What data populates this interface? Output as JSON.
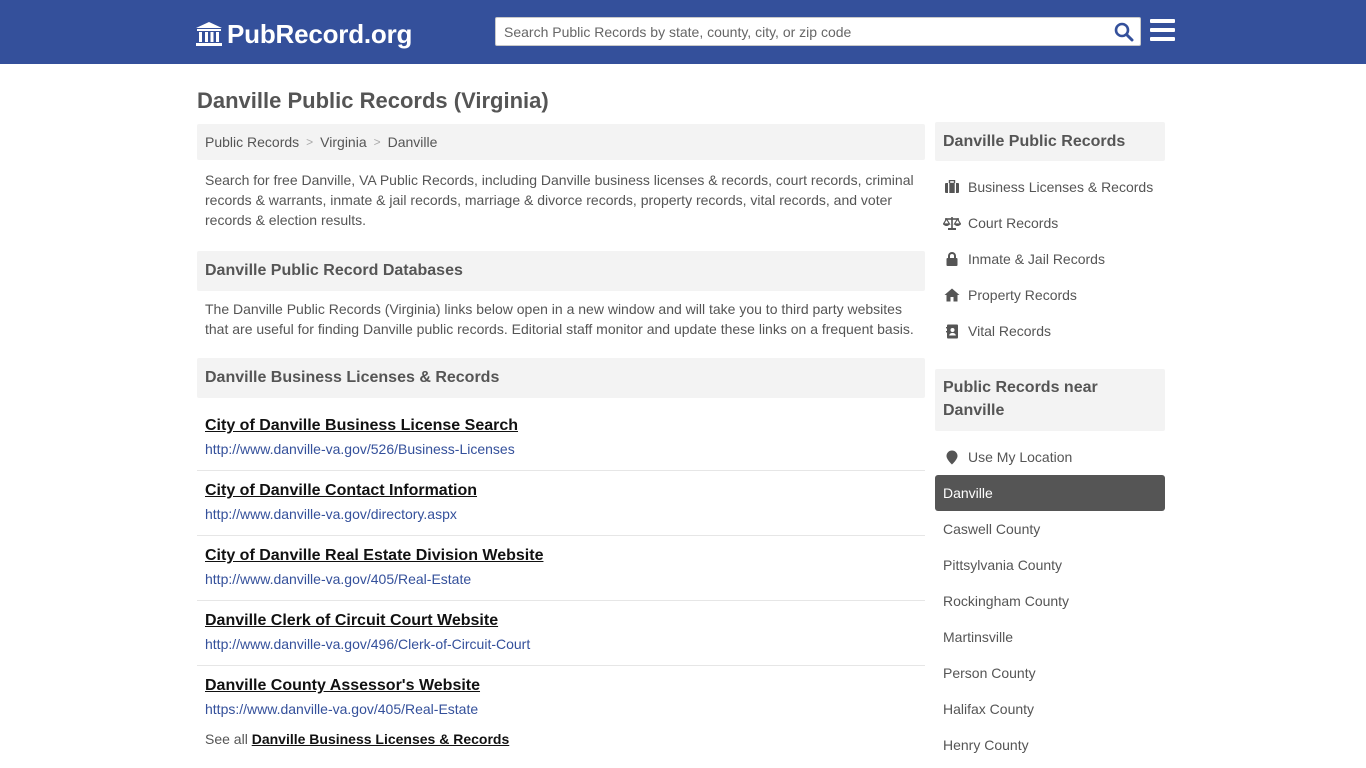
{
  "header": {
    "logo_text": "PubRecord.org",
    "search_placeholder": "Search Public Records by state, county, city, or zip code",
    "colors": {
      "bar": "#34509b",
      "link": "#34509b"
    }
  },
  "page_title": "Danville Public Records (Virginia)",
  "breadcrumb": [
    "Public Records",
    "Virginia",
    "Danville"
  ],
  "intro": "Search for free Danville, VA Public Records, including Danville business licenses & records, court records, criminal records & warrants, inmate & jail records, marriage & divorce records, property records, vital records, and voter records & election results.",
  "databases": {
    "heading": "Danville Public Record Databases",
    "description": "The Danville Public Records (Virginia) links below open in a new window and will take you to third party websites that are useful for finding Danville public records. Editorial staff monitor and update these links on a frequent basis."
  },
  "business": {
    "heading": "Danville Business Licenses & Records",
    "records": [
      {
        "title": "City of Danville Business License Search",
        "url": "http://www.danville-va.gov/526/Business-Licenses"
      },
      {
        "title": "City of Danville Contact Information",
        "url": "http://www.danville-va.gov/directory.aspx"
      },
      {
        "title": "City of Danville Real Estate Division Website",
        "url": "http://www.danville-va.gov/405/Real-Estate"
      },
      {
        "title": "Danville Clerk of Circuit Court Website",
        "url": "http://www.danville-va.gov/496/Clerk-of-Circuit-Court"
      },
      {
        "title": "Danville County Assessor's Website",
        "url": "https://www.danville-va.gov/405/Real-Estate"
      }
    ],
    "see_all_prefix": "See all",
    "see_all_link": "Danville Business Licenses & Records"
  },
  "sidebar": {
    "records_heading": "Danville Public Records",
    "records_links": [
      {
        "label": "Business Licenses & Records",
        "icon": "briefcase-icon"
      },
      {
        "label": "Court Records",
        "icon": "scales-icon"
      },
      {
        "label": "Inmate & Jail Records",
        "icon": "lock-icon"
      },
      {
        "label": "Property Records",
        "icon": "home-icon"
      },
      {
        "label": "Vital Records",
        "icon": "contact-book-icon"
      }
    ],
    "nearby_heading": "Public Records near Danville",
    "use_location": "Use My Location",
    "nearby": [
      "Danville",
      "Caswell County",
      "Pittsylvania County",
      "Rockingham County",
      "Martinsville",
      "Person County",
      "Halifax County",
      "Henry County"
    ],
    "active": "Danville"
  }
}
